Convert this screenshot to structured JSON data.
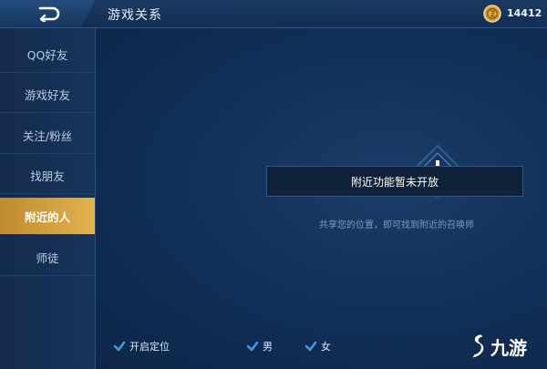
{
  "header": {
    "title": "游戏关系",
    "coin_count": "14412"
  },
  "sidebar": {
    "items": [
      {
        "label": "QQ好友",
        "active": false
      },
      {
        "label": "游戏好友",
        "active": false
      },
      {
        "label": "关注/粉丝",
        "active": false
      },
      {
        "label": "找朋友",
        "active": false
      },
      {
        "label": "附近的人",
        "active": true
      },
      {
        "label": "师徒",
        "active": false
      }
    ]
  },
  "main": {
    "notice": "附近功能暂未开放",
    "hint": "共享您的位置，即可找到附近的召唤师"
  },
  "filters": {
    "location_label": "开启定位",
    "male_label": "男",
    "female_label": "女",
    "location_checked": true,
    "male_checked": true,
    "female_checked": true
  },
  "watermark": {
    "text": "九游"
  },
  "colors": {
    "accent_gold": "#e3b34f",
    "check_blue": "#3fa0e8",
    "background": "#0c2340"
  }
}
